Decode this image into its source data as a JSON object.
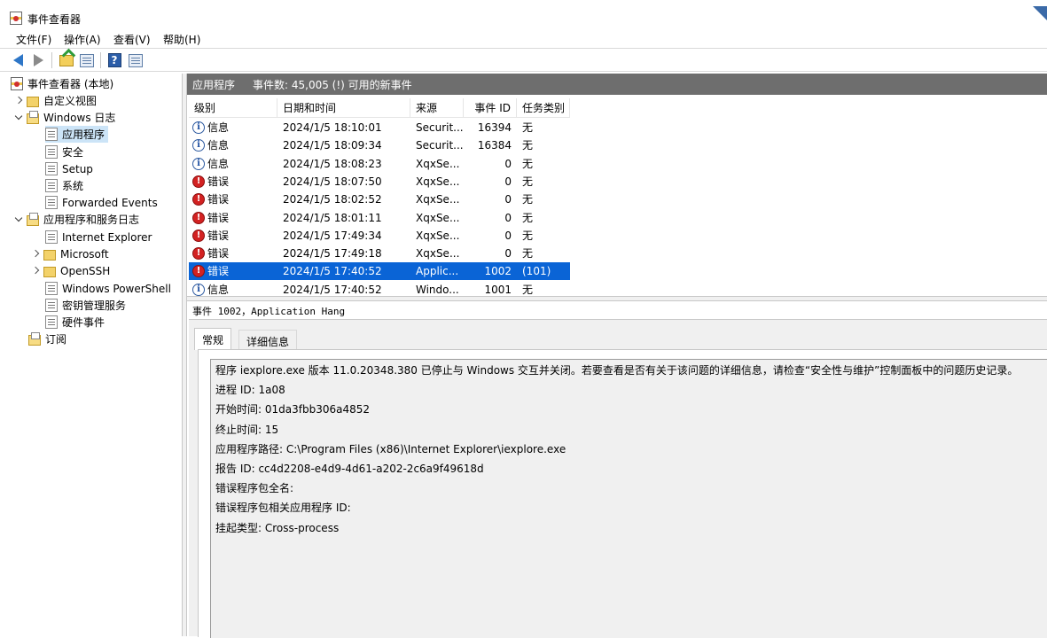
{
  "window": {
    "title": "事件查看器"
  },
  "menu": [
    "文件(F)",
    "操作(A)",
    "查看(V)",
    "帮助(H)"
  ],
  "toolbar": {
    "buttons": [
      "back-icon",
      "forward-icon",
      "up-folder-icon",
      "show-hide-tree-icon",
      "help-icon",
      "properties-icon"
    ]
  },
  "tree": {
    "root": "事件查看器 (本地)",
    "custom_views": "自定义视图",
    "windows_logs": "Windows 日志",
    "application": "应用程序",
    "security": "安全",
    "setup": "Setup",
    "system": "系统",
    "forwarded": "Forwarded Events",
    "app_service_logs": "应用程序和服务日志",
    "ie": "Internet Explorer",
    "microsoft": "Microsoft",
    "openssh": "OpenSSH",
    "powershell": "Windows PowerShell",
    "key_mgmt": "密钥管理服务",
    "hardware": "硬件事件",
    "subscriptions": "订阅"
  },
  "header": {
    "title": "应用程序",
    "count": "事件数: 45,005 (!) 可用的新事件"
  },
  "columns": {
    "level": "级别",
    "date": "日期和时间",
    "source": "来源",
    "event_id": "事件 ID",
    "task": "任务类别"
  },
  "rows": [
    {
      "level": "信息",
      "type": "info",
      "date": "2024/1/5 18:10:01",
      "source": "Securit...",
      "id": "16394",
      "task": "无"
    },
    {
      "level": "信息",
      "type": "info",
      "date": "2024/1/5 18:09:34",
      "source": "Securit...",
      "id": "16384",
      "task": "无"
    },
    {
      "level": "信息",
      "type": "info",
      "date": "2024/1/5 18:08:23",
      "source": "XqxSe...",
      "id": "0",
      "task": "无"
    },
    {
      "level": "错误",
      "type": "error",
      "date": "2024/1/5 18:07:50",
      "source": "XqxSe...",
      "id": "0",
      "task": "无"
    },
    {
      "level": "错误",
      "type": "error",
      "date": "2024/1/5 18:02:52",
      "source": "XqxSe...",
      "id": "0",
      "task": "无"
    },
    {
      "level": "错误",
      "type": "error",
      "date": "2024/1/5 18:01:11",
      "source": "XqxSe...",
      "id": "0",
      "task": "无"
    },
    {
      "level": "错误",
      "type": "error",
      "date": "2024/1/5 17:49:34",
      "source": "XqxSe...",
      "id": "0",
      "task": "无"
    },
    {
      "level": "错误",
      "type": "error",
      "date": "2024/1/5 17:49:18",
      "source": "XqxSe...",
      "id": "0",
      "task": "无"
    },
    {
      "level": "错误",
      "type": "error",
      "date": "2024/1/5 17:40:52",
      "source": "Applic...",
      "id": "1002",
      "task": "(101)"
    },
    {
      "level": "信息",
      "type": "info",
      "date": "2024/1/5 17:40:52",
      "source": "Windo...",
      "id": "1001",
      "task": "无"
    }
  ],
  "selected_row": 8,
  "detail": {
    "title": "事件 1002，Application Hang",
    "tab_general": "常规",
    "tab_details": "详细信息",
    "lines": [
      "程序 iexplore.exe 版本 11.0.20348.380 已停止与 Windows 交互并关闭。若要查看是否有关于该问题的详细信息，请检查“安全性与维护”控制面板中的问题历史记录。",
      "进程 ID: 1a08",
      "开始时间: 01da3fbb306a4852",
      "终止时间: 15",
      "应用程序路径: C:\\Program Files (x86)\\Internet Explorer\\iexplore.exe",
      "报告 ID: cc4d2208-e4d9-4d61-a202-2c6a9f49618d",
      "错误程序包全名:",
      "错误程序包相关应用程序 ID:",
      "挂起类型: Cross-process"
    ]
  },
  "colors": {
    "header_bg": "#6e6e6e",
    "selection": "#0a64d6",
    "error": "#d32222",
    "info": "#2d5aa0"
  }
}
